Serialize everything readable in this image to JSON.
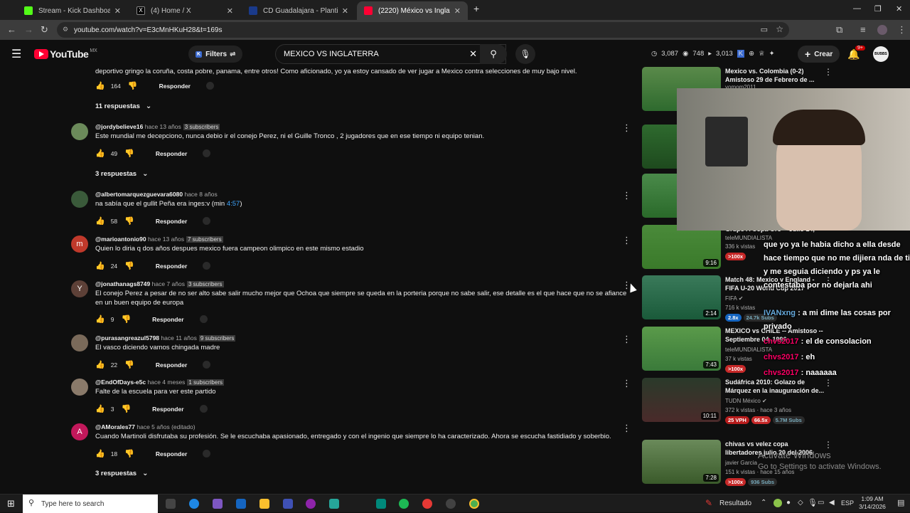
{
  "browser": {
    "tabs": [
      {
        "title": "Stream - Kick Dashboard",
        "color": "#53fc18",
        "active": false
      },
      {
        "title": "(4) Home / X",
        "color": "#ffffff",
        "active": false
      },
      {
        "title": "CD Guadalajara - Plantilla detal",
        "color": "#1a3a8a",
        "active": false
      },
      {
        "title": "(2220) México vs Inglaterra am",
        "color": "#ff0033",
        "active": true
      }
    ],
    "new_tab": "+",
    "url": "youtube.com/watch?v=E3cMnHKuH28&t=169s"
  },
  "youtube": {
    "logo": "YouTube",
    "region": "MX",
    "filters_label": "Filters",
    "search_value": "MEXICO VS INGLATERRA",
    "stats": {
      "a": "3,087",
      "b": "748",
      "c": "3,013"
    },
    "create_label": "Crear",
    "notif_count": "9+",
    "avatar_text": "BUBBS"
  },
  "comments": [
    {
      "text": "deportivo gringo la coruña, costa pobre, panama, entre otros! Como aficionado, yo ya estoy cansado de ver jugar a Mexico contra selecciones de muy bajo nivel.",
      "likes": "164",
      "reply": "Responder",
      "replies": "11 respuestas"
    },
    {
      "handle": "@jordybelieve16",
      "time": "hace 13 años",
      "subs": "3 subscribers",
      "text": "Este mundial me decepciono, nunca debio ir el conejo Perez, ni el Guille Tronco , 2 jugadores que en ese tiempo ni equipo tenian.",
      "likes": "49",
      "reply": "Responder",
      "replies": "3 respuestas",
      "avatar_color": "#6b8a5a",
      "avatar_letter": ""
    },
    {
      "handle": "@albertomarquezguevara6080",
      "time": "hace 8 años",
      "text": "na sabía que el gullit Peña era inges:v (min ",
      "link": "4:57",
      "text_end": ")",
      "likes": "58",
      "reply": "Responder",
      "avatar_color": "#3a5a3a",
      "avatar_letter": ""
    },
    {
      "handle": "@marioantonio90",
      "time": "hace 13 años",
      "subs": "7 subscribers",
      "text": "Quien lo diria q dos años despues mexico fuera campeon olimpico en este mismo estadio",
      "likes": "24",
      "reply": "Responder",
      "avatar_color": "#c0392b",
      "avatar_letter": "m"
    },
    {
      "handle": "@jonathanags8749",
      "time": "hace 7 años",
      "subs": "3 subscribers",
      "text": "El conejo Perez a pesar de no ser alto sabe salir mucho mejor que Ochoa que siempre se queda en la porteria porque no sabe salir, ese detalle es el que hace que no se afiance en un buen equipo de europa",
      "likes": "9",
      "reply": "Responder",
      "avatar_color": "#5d4037",
      "avatar_letter": "Y"
    },
    {
      "handle": "@purasangreazul5798",
      "time": "hace 11 años",
      "subs": "9 subscribers",
      "text": "El vasco diciendo vamos chingada madre",
      "likes": "22",
      "reply": "Responder",
      "avatar_color": "#7a6a5a",
      "avatar_letter": ""
    },
    {
      "handle": "@EndOfDays-e5c",
      "time": "hace 4 meses",
      "subs": "1 subscribers",
      "text": "Falte de la escuela para ver este partido",
      "likes": "3",
      "reply": "Responder",
      "avatar_color": "#8a7a6a",
      "avatar_letter": ""
    },
    {
      "handle": "@AMorales77",
      "time": "hace 5 años (editado)",
      "text": "Cuando Martinoli disfrutaba su profesión. Se le escuchaba apasionado, entregado y con el ingenio que siempre lo ha caracterizado. Ahora se escucha fastidiado y soberbio.",
      "likes": "18",
      "reply": "Responder",
      "replies": "3 respuestas",
      "avatar_color": "#c2185b",
      "avatar_letter": "A"
    }
  ],
  "related": [
    {
      "title": "Mexico vs. Colombia (0-2) Amistoso 29 de Febrero de ...",
      "channel": "yomom2011",
      "thumb_color": "#4a7a3a"
    },
    {
      "title": "",
      "channel": "",
      "thumb_color": "#2e6a2e"
    },
    {
      "title": "",
      "channel": "",
      "thumb_color": "#3a7a3a"
    },
    {
      "title": "Grupo A Copa Oro -- Julio 14,",
      "channel": "teleMUNDIALISTA",
      "meta": "336 k vistas",
      "duration": "9:16",
      "tag1": ">100x",
      "thumb_color": "#3d7a36"
    },
    {
      "title": "Match 48: Mexico v England - FIFA U-20 World Cup 2017",
      "channel": "FIFA",
      "meta": "716 k vistas",
      "duration": "2:14",
      "tag1": "2.8x",
      "tag2": "24.7k Subs",
      "thumb_color": "#2a6a4a"
    },
    {
      "title": "MEXICO vs CHILE -- Amistoso -- Septiembre 04, 1996",
      "channel": "teleMUNDIALISTA",
      "meta": "37 k vistas",
      "duration": "7:43",
      "tag1": ">100x",
      "thumb_color": "#3a8a3a"
    },
    {
      "title": "Sudáfrica 2010: Golazo de Márquez en la inauguración de...",
      "channel": "TUDN México",
      "meta": "372 k vistas · hace 3 años",
      "duration": "10:11",
      "tag1": "25 VPH",
      "tag2": "66.5x",
      "tag3": "5.7M Subs",
      "thumb_color": "#2a4a2a"
    },
    {
      "title": "chivas vs velez copa libertadores julio 20 del 2006",
      "channel": "javier Garcia",
      "meta": "151 k vistas · hace 15 años",
      "duration": "7:28",
      "tag1": ">100x",
      "tag2": "936 Subs",
      "thumb_color": "#4a6a3a"
    }
  ],
  "chat": [
    {
      "text": "que yo ya le habia dicho a ella desde hace tiempo que no me dijiera nda de ti y me seguia diciendo y ps ya le contestaba por no dejarla ahi"
    },
    {
      "user": "IVANxng",
      "text": ": a mi dime las cosas por privado"
    },
    {
      "user": "chvs2017",
      "text": ": el de consolacion"
    },
    {
      "user": "chvs2017",
      "text": ": eh"
    },
    {
      "user": "chvs2017",
      "text": ": naaaaaa"
    }
  ],
  "watermark": {
    "line1": "Activate Windows",
    "line2": "Go to Settings to activate Windows."
  },
  "taskbar": {
    "search_placeholder": "Type here to search",
    "weather": "Resultado",
    "lang": "ESP",
    "time": "1:09 AM",
    "date": "3/14/2026"
  }
}
